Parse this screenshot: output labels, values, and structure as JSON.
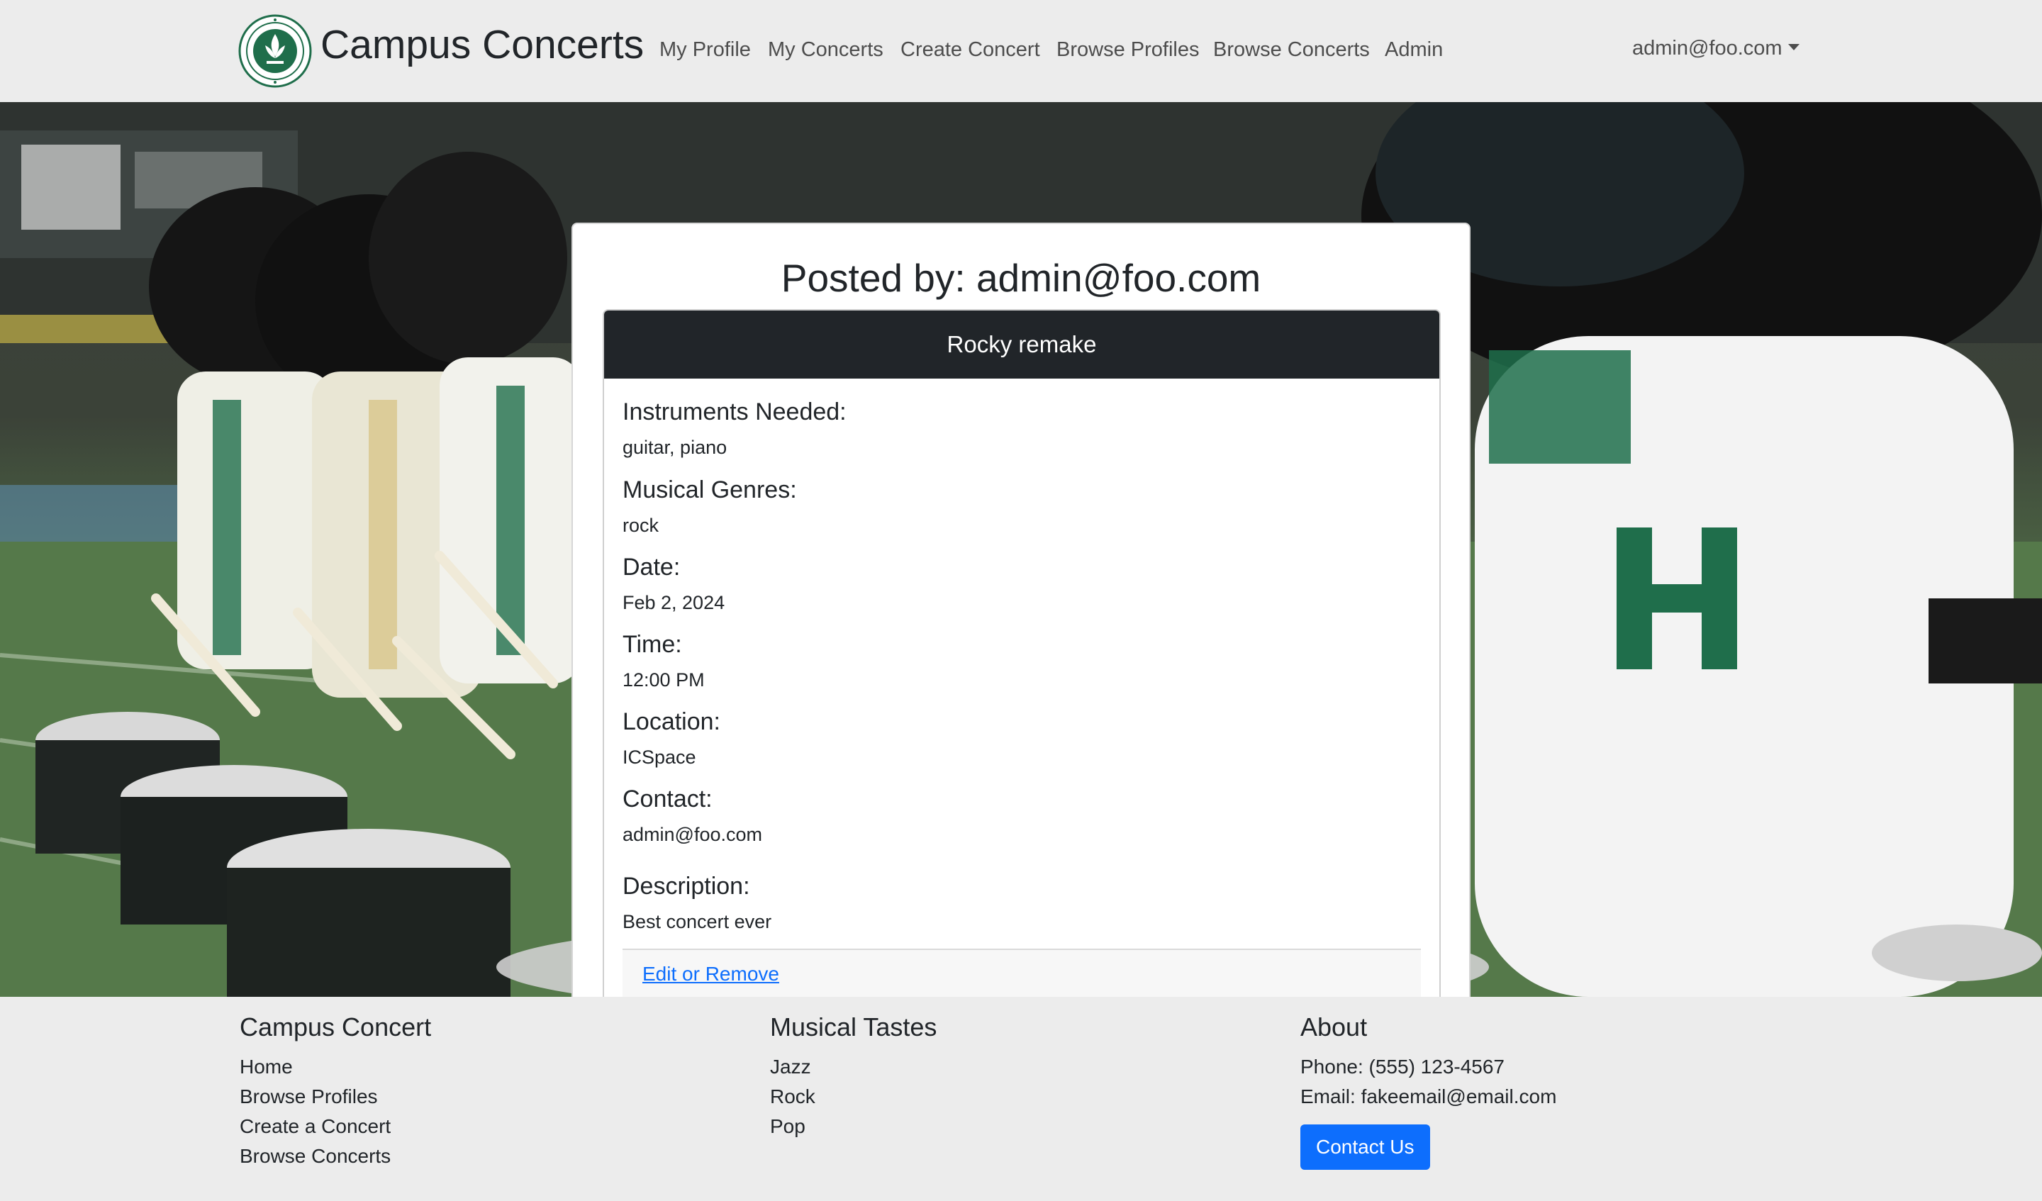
{
  "brand": {
    "name": "Campus Concerts",
    "logo_icon": "university-seal-icon"
  },
  "nav": {
    "links": [
      "My Profile",
      "My Concerts",
      "Create Concert",
      "Browse Profiles",
      "Browse Concerts",
      "Admin"
    ],
    "user": "admin@foo.com"
  },
  "hero": {
    "background": "marching-band-drumline-photo"
  },
  "concert": {
    "posted_by": "Posted by: admin@foo.com",
    "title": "Rocky remake",
    "fields": [
      {
        "label": "Instruments Needed:",
        "value": "guitar, piano"
      },
      {
        "label": "Musical Genres:",
        "value": "rock"
      },
      {
        "label": "Date:",
        "value": "Feb 2, 2024"
      },
      {
        "label": "Time:",
        "value": "12:00 PM"
      },
      {
        "label": "Location:",
        "value": "ICSpace"
      },
      {
        "label": "Contact:",
        "value": "admin@foo.com"
      },
      {
        "label": "Description:",
        "value": "Best concert ever"
      }
    ],
    "edit_label": "Edit or Remove"
  },
  "footer": {
    "col1": {
      "heading": "Campus Concert",
      "items": [
        "Home",
        "Browse Profiles",
        "Create a Concert",
        "Browse Concerts"
      ]
    },
    "col2": {
      "heading": "Musical Tastes",
      "items": [
        "Jazz",
        "Rock",
        "Pop"
      ]
    },
    "col3": {
      "heading": "About",
      "items": [
        "Phone: (555) 123-4567",
        "Email: fakeemail@email.com"
      ],
      "button": "Contact Us"
    }
  },
  "colors": {
    "accent": "#0d6efd",
    "card_header": "#212529",
    "navbar_bg": "#ececec",
    "uh_green": "#1f6e4b"
  }
}
